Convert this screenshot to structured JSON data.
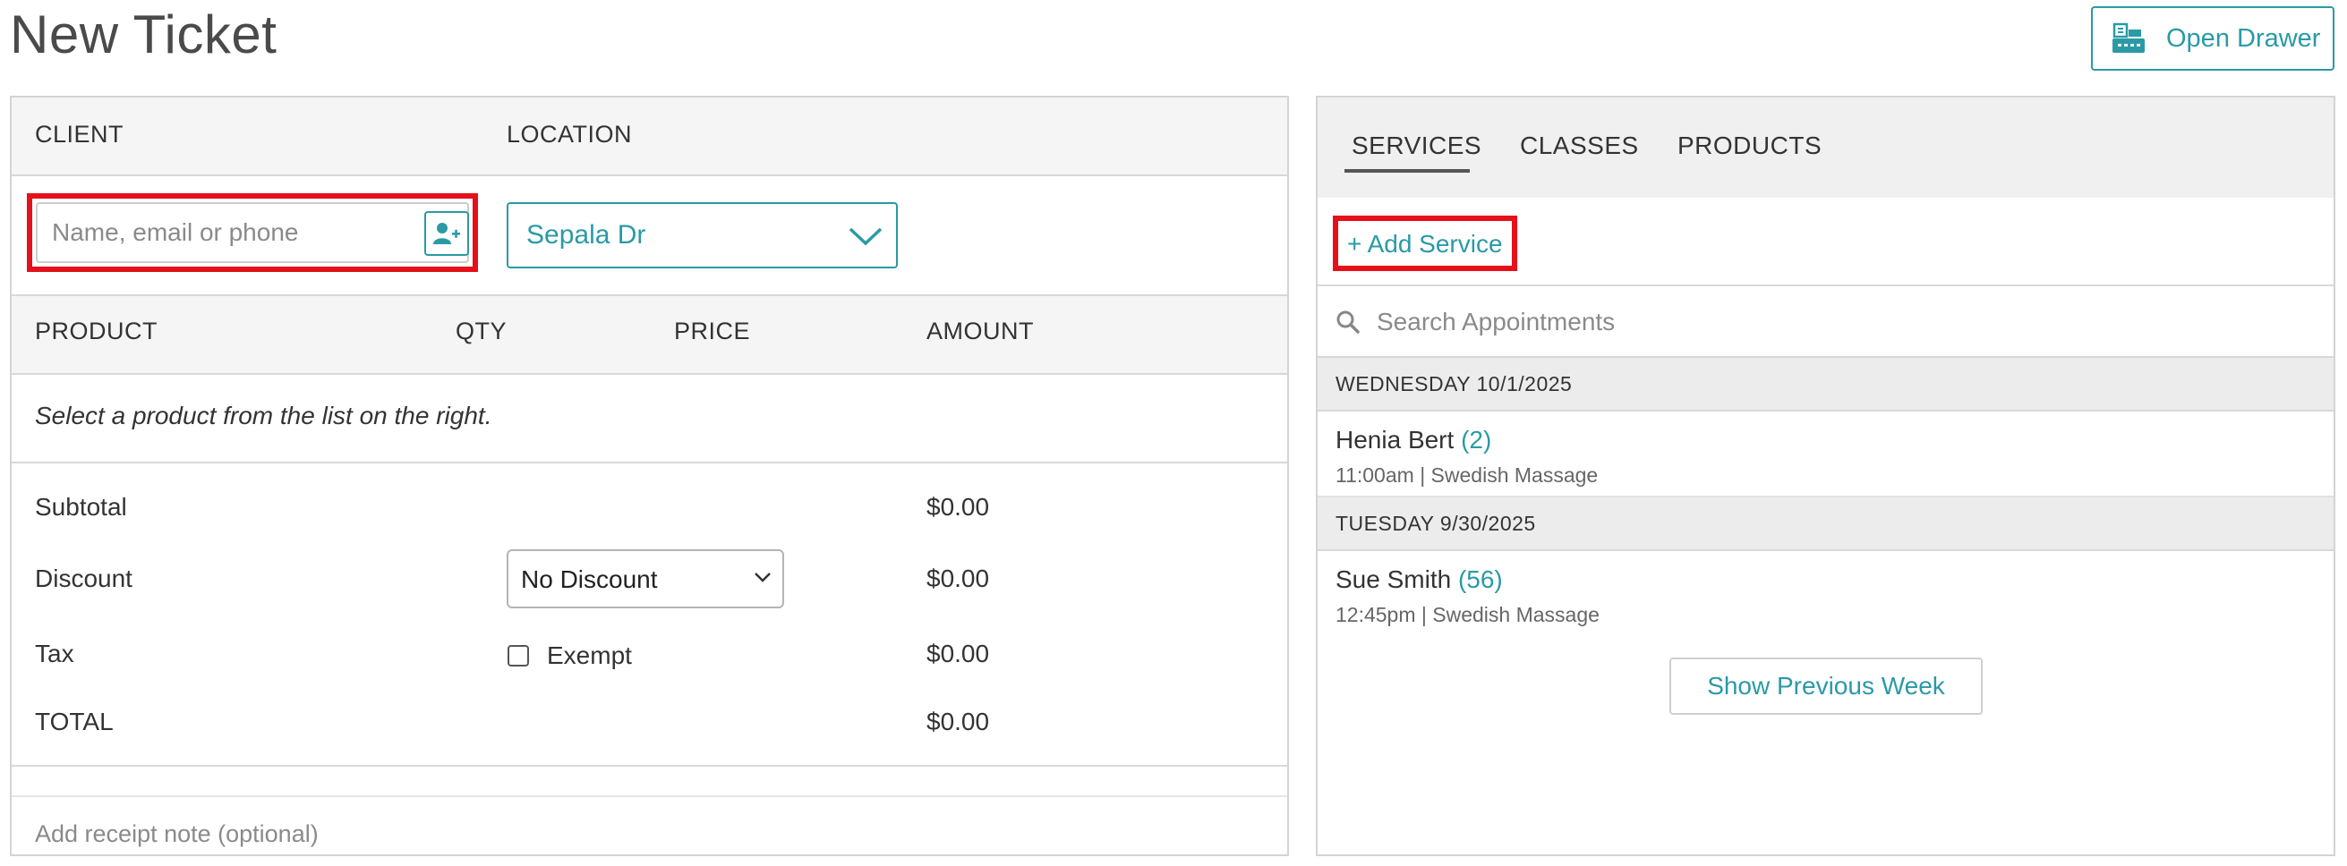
{
  "page": {
    "title": "New Ticket"
  },
  "toolbar": {
    "open_drawer_label": "Open Drawer"
  },
  "ticket": {
    "client_header": "CLIENT",
    "location_header": "LOCATION",
    "client_placeholder": "Name, email or phone",
    "location_value": "Sepala Dr",
    "columns": {
      "product": "PRODUCT",
      "qty": "QTY",
      "price": "PRICE",
      "amount": "AMOUNT"
    },
    "empty_message": "Select a product from the list on the right.",
    "summary": {
      "subtotal_label": "Subtotal",
      "subtotal_value": "$0.00",
      "discount_label": "Discount",
      "discount_select": "No Discount",
      "discount_value": "$0.00",
      "tax_label": "Tax",
      "exempt_label": "Exempt",
      "exempt_checked": false,
      "tax_value": "$0.00",
      "total_label": "TOTAL",
      "total_value": "$0.00"
    },
    "note_placeholder": "Add receipt note (optional)"
  },
  "catalog": {
    "tabs": [
      {
        "label": "SERVICES",
        "active": true
      },
      {
        "label": "CLASSES",
        "active": false
      },
      {
        "label": "PRODUCTS",
        "active": false
      }
    ],
    "add_service_label": "+ Add Service",
    "search_placeholder": "Search Appointments",
    "days": [
      {
        "header": "WEDNESDAY 10/1/2025",
        "appointments": [
          {
            "name": "Henia Bert",
            "count": "(2)",
            "detail": "11:00am | Swedish Massage"
          }
        ]
      },
      {
        "header": "TUESDAY 9/30/2025",
        "appointments": [
          {
            "name": "Sue Smith",
            "count": "(56)",
            "detail": "12:45pm | Swedish Massage"
          }
        ]
      }
    ],
    "show_previous_label": "Show Previous Week"
  },
  "colors": {
    "accent": "#2a9aa6",
    "highlight": "#e5101a",
    "header_bg": "#f5f5f5"
  },
  "icons": {
    "drawer": "cash-register-icon",
    "add_client": "add-user-icon",
    "location_chevron": "chevron-down-icon",
    "discount_chevron": "chevron-down-icon",
    "search": "search-icon"
  }
}
